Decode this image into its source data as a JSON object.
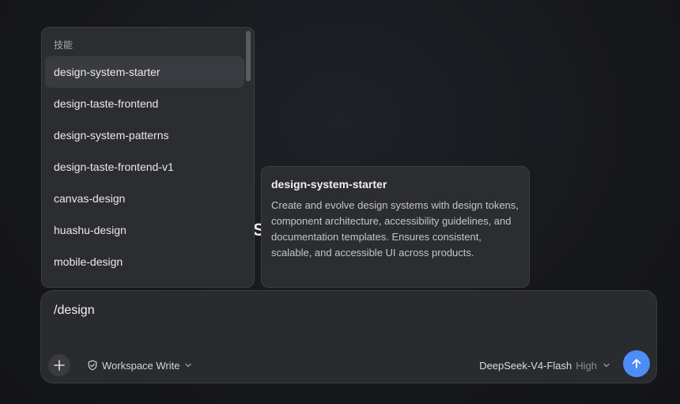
{
  "skills_popup": {
    "section_label": "技能",
    "items": [
      {
        "label": "design-system-starter",
        "active": true
      },
      {
        "label": "design-taste-frontend"
      },
      {
        "label": "design-system-patterns"
      },
      {
        "label": "design-taste-frontend-v1"
      },
      {
        "label": "canvas-design"
      },
      {
        "label": "huashu-design"
      },
      {
        "label": "mobile-design"
      }
    ]
  },
  "detail": {
    "title": "design-system-starter",
    "description": "Create and evolve design systems with design tokens, component architecture, accessibility guidelines, and documentation templates. Ensures consistent, scalable, and accessible UI across products."
  },
  "composer": {
    "input_value": "/design",
    "permission_label": "Workspace Write",
    "model_name": "DeepSeek-V4-Flash",
    "model_level": "High",
    "accent_color": "#4c8df6"
  }
}
